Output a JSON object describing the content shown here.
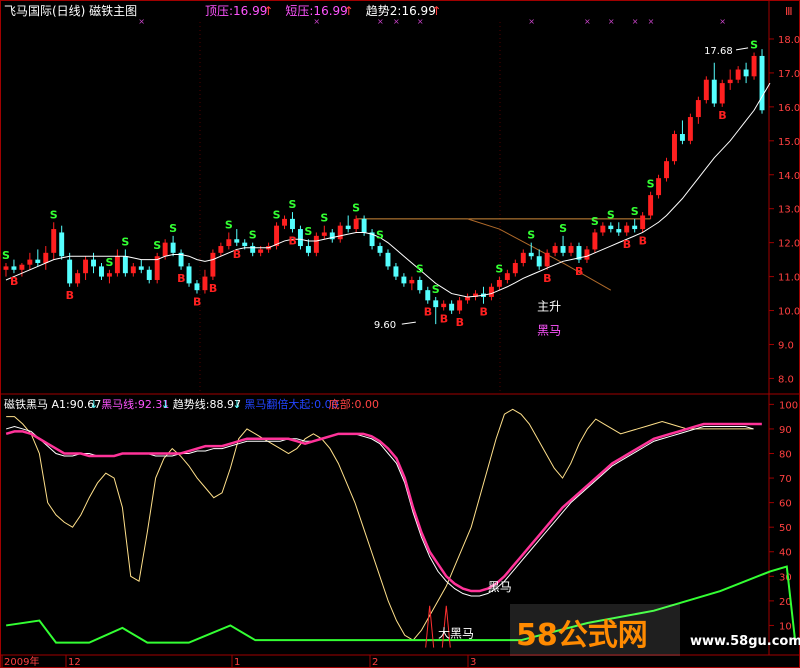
{
  "top_panel": {
    "title": "飞马国际(日线) 磁铁主图",
    "indicators": [
      {
        "label": "顶压:16.99",
        "arrow": "↑",
        "color": "#ff55ff"
      },
      {
        "label": "短压:16.99",
        "arrow": "↑",
        "color": "#ff55ff"
      },
      {
        "label": "趋势2:16.99",
        "arrow": "↑",
        "color": "#ffffff"
      }
    ],
    "corner_label": "Ⅲ"
  },
  "bottom_panel": {
    "indicators": [
      {
        "label": "磁铁黑马 A1:90.67",
        "arrow": "↓",
        "color": "#ffffff"
      },
      {
        "label": "黑马线:92.31",
        "arrow": "↓",
        "color": "#ff55ff"
      },
      {
        "label": "趋势线:88.97",
        "arrow": "↓",
        "color": "#ffffff"
      },
      {
        "label": "黑马翻倍大起:0.00",
        "arrow": "",
        "color": "#2244ff"
      },
      {
        "label": "底部:0.00",
        "arrow": "",
        "color": "#ff4444"
      }
    ]
  },
  "x_axis": {
    "labels": [
      "2009年",
      "12",
      "1",
      "2",
      "3"
    ]
  },
  "watermark": {
    "brand": "58公式网",
    "url": "www.58gu.com"
  },
  "colors": {
    "up": "#ff2020",
    "down": "#55ffff",
    "ma": "#ffffff",
    "ma2": "#ffe08a",
    "pink": "#ff3399",
    "green": "#33ff33",
    "pink_line": "#ff55ff"
  },
  "chart_data": [
    {
      "type": "candlestick",
      "title": "",
      "ylim": [
        7.6,
        18.5
      ],
      "y_ticks": [
        8.0,
        9.0,
        10.0,
        11.0,
        12.0,
        13.0,
        14.0,
        15.0,
        16.0,
        17.0,
        18.0
      ],
      "ohlc": [
        [
          11.2,
          11.4,
          11.0,
          11.3
        ],
        [
          11.3,
          11.5,
          11.1,
          11.2
        ],
        [
          11.2,
          11.4,
          11.0,
          11.35
        ],
        [
          11.35,
          11.7,
          11.2,
          11.5
        ],
        [
          11.5,
          11.8,
          11.3,
          11.4
        ],
        [
          11.4,
          11.9,
          11.2,
          11.7
        ],
        [
          11.7,
          12.6,
          11.5,
          12.4
        ],
        [
          12.3,
          12.5,
          11.5,
          11.6
        ],
        [
          11.5,
          11.7,
          10.7,
          10.8
        ],
        [
          10.8,
          11.2,
          10.7,
          11.1
        ],
        [
          11.1,
          11.6,
          10.9,
          11.5
        ],
        [
          11.5,
          11.7,
          11.1,
          11.3
        ],
        [
          11.3,
          11.4,
          10.9,
          11.0
        ],
        [
          11.0,
          11.2,
          10.8,
          11.1
        ],
        [
          11.1,
          11.8,
          11.0,
          11.6
        ],
        [
          11.6,
          11.8,
          11.0,
          11.1
        ],
        [
          11.1,
          11.4,
          11.0,
          11.3
        ],
        [
          11.3,
          11.5,
          11.1,
          11.2
        ],
        [
          11.2,
          11.3,
          10.8,
          10.9
        ],
        [
          10.9,
          11.7,
          10.8,
          11.6
        ],
        [
          11.6,
          12.1,
          11.5,
          12.0
        ],
        [
          12.0,
          12.2,
          11.6,
          11.7
        ],
        [
          11.7,
          11.8,
          11.2,
          11.3
        ],
        [
          11.3,
          11.4,
          10.7,
          10.8
        ],
        [
          10.8,
          10.9,
          10.5,
          10.6
        ],
        [
          10.6,
          11.2,
          10.5,
          11.0
        ],
        [
          11.0,
          11.8,
          10.9,
          11.7
        ],
        [
          11.7,
          12.0,
          11.6,
          11.9
        ],
        [
          11.9,
          12.3,
          11.8,
          12.1
        ],
        [
          12.1,
          12.4,
          11.9,
          12.0
        ],
        [
          12.0,
          12.1,
          11.8,
          11.9
        ],
        [
          11.9,
          12.0,
          11.6,
          11.7
        ],
        [
          11.7,
          11.9,
          11.6,
          11.8
        ],
        [
          11.8,
          12.0,
          11.7,
          11.9
        ],
        [
          11.9,
          12.6,
          11.8,
          12.5
        ],
        [
          12.5,
          12.8,
          12.4,
          12.7
        ],
        [
          12.7,
          12.9,
          12.3,
          12.4
        ],
        [
          12.4,
          12.5,
          11.8,
          11.9
        ],
        [
          11.9,
          12.1,
          11.6,
          11.7
        ],
        [
          11.7,
          12.3,
          11.6,
          12.2
        ],
        [
          12.2,
          12.5,
          12.1,
          12.3
        ],
        [
          12.3,
          12.4,
          12.0,
          12.1
        ],
        [
          12.1,
          12.6,
          12.0,
          12.5
        ],
        [
          12.5,
          12.8,
          12.3,
          12.4
        ],
        [
          12.4,
          12.8,
          12.3,
          12.7
        ],
        [
          12.7,
          12.8,
          12.2,
          12.3
        ],
        [
          12.3,
          12.4,
          11.8,
          11.9
        ],
        [
          11.9,
          12.0,
          11.6,
          11.7
        ],
        [
          11.7,
          11.8,
          11.2,
          11.3
        ],
        [
          11.3,
          11.4,
          10.9,
          11.0
        ],
        [
          11.0,
          11.1,
          10.7,
          10.8
        ],
        [
          10.8,
          11.0,
          10.6,
          10.9
        ],
        [
          10.9,
          11.0,
          10.5,
          10.6
        ],
        [
          10.6,
          10.7,
          10.2,
          10.3
        ],
        [
          10.3,
          10.4,
          9.6,
          10.1
        ],
        [
          10.1,
          10.3,
          10.0,
          10.2
        ],
        [
          10.2,
          10.3,
          9.9,
          10.0
        ],
        [
          10.0,
          10.4,
          9.9,
          10.3
        ],
        [
          10.3,
          10.5,
          10.2,
          10.4
        ],
        [
          10.4,
          10.6,
          10.3,
          10.5
        ],
        [
          10.5,
          10.7,
          10.2,
          10.4
        ],
        [
          10.4,
          10.8,
          10.3,
          10.7
        ],
        [
          10.7,
          11.0,
          10.6,
          10.9
        ],
        [
          10.9,
          11.2,
          10.8,
          11.1
        ],
        [
          11.1,
          11.5,
          11.0,
          11.4
        ],
        [
          11.4,
          11.8,
          11.3,
          11.7
        ],
        [
          11.7,
          12.0,
          11.5,
          11.6
        ],
        [
          11.6,
          11.8,
          11.2,
          11.3
        ],
        [
          11.3,
          11.8,
          11.2,
          11.7
        ],
        [
          11.7,
          12.0,
          11.6,
          11.9
        ],
        [
          11.9,
          12.2,
          11.6,
          11.7
        ],
        [
          11.7,
          12.0,
          11.6,
          11.9
        ],
        [
          11.9,
          12.0,
          11.4,
          11.5
        ],
        [
          11.5,
          11.9,
          11.4,
          11.8
        ],
        [
          11.8,
          12.4,
          11.7,
          12.3
        ],
        [
          12.3,
          12.6,
          12.2,
          12.5
        ],
        [
          12.5,
          12.6,
          12.3,
          12.4
        ],
        [
          12.4,
          12.6,
          12.2,
          12.3
        ],
        [
          12.3,
          12.6,
          12.2,
          12.5
        ],
        [
          12.5,
          12.7,
          12.3,
          12.4
        ],
        [
          12.4,
          12.9,
          12.3,
          12.8
        ],
        [
          12.8,
          13.5,
          12.7,
          13.4
        ],
        [
          13.4,
          14.0,
          13.3,
          13.9
        ],
        [
          13.9,
          14.5,
          13.8,
          14.4
        ],
        [
          14.4,
          15.3,
          14.3,
          15.2
        ],
        [
          15.2,
          15.6,
          14.9,
          15.0
        ],
        [
          15.0,
          15.8,
          14.9,
          15.7
        ],
        [
          15.7,
          16.3,
          15.5,
          16.2
        ],
        [
          16.2,
          16.9,
          16.1,
          16.8
        ],
        [
          16.8,
          17.3,
          16.0,
          16.1
        ],
        [
          16.1,
          16.8,
          16.0,
          16.7
        ],
        [
          16.7,
          17.1,
          16.5,
          16.8
        ],
        [
          16.8,
          17.2,
          16.7,
          17.1
        ],
        [
          17.1,
          17.3,
          16.7,
          16.9
        ],
        [
          16.9,
          17.6,
          16.8,
          17.5
        ],
        [
          17.5,
          17.7,
          15.8,
          15.9
        ]
      ],
      "ma_line": [
        10.9,
        11.0,
        11.1,
        11.2,
        11.3,
        11.4,
        11.5,
        11.55,
        11.6,
        11.6,
        11.6,
        11.6,
        11.6,
        11.6,
        11.6,
        11.6,
        11.55,
        11.5,
        11.5,
        11.5,
        11.6,
        11.65,
        11.65,
        11.6,
        11.5,
        11.45,
        11.5,
        11.6,
        11.7,
        11.8,
        11.85,
        11.85,
        11.85,
        11.85,
        11.95,
        12.05,
        12.1,
        12.1,
        12.05,
        12.05,
        12.1,
        12.15,
        12.2,
        12.25,
        12.3,
        12.3,
        12.25,
        12.15,
        12.0,
        11.8,
        11.6,
        11.4,
        11.2,
        11.0,
        10.8,
        10.65,
        10.5,
        10.45,
        10.4,
        10.42,
        10.45,
        10.5,
        10.6,
        10.7,
        10.82,
        10.95,
        11.05,
        11.15,
        11.25,
        11.35,
        11.45,
        11.5,
        11.55,
        11.6,
        11.7,
        11.8,
        11.9,
        12.0,
        12.1,
        12.2,
        12.3,
        12.45,
        12.6,
        12.8,
        13.05,
        13.3,
        13.6,
        13.9,
        14.2,
        14.5,
        14.75,
        15.0,
        15.3,
        15.6,
        15.9,
        16.3,
        16.7
      ],
      "ma2_line": [
        null,
        null,
        null,
        null,
        null,
        null,
        null,
        null,
        null,
        null,
        null,
        null,
        null,
        null,
        null,
        null,
        null,
        null,
        null,
        null,
        null,
        null,
        null,
        null,
        null,
        null,
        null,
        null,
        null,
        null,
        null,
        null,
        null,
        null,
        null,
        null,
        null,
        null,
        null,
        null,
        null,
        null,
        null,
        null,
        null,
        null,
        null,
        null,
        null,
        null,
        null,
        null,
        null,
        null,
        null,
        null,
        null,
        null,
        null,
        null,
        null,
        null,
        null,
        null,
        null,
        null,
        null,
        null,
        null,
        null,
        null,
        null,
        null,
        null,
        null,
        null,
        null,
        null,
        null,
        null,
        null,
        null,
        null,
        null,
        null,
        null,
        null,
        null,
        null,
        null,
        null,
        null,
        null,
        null,
        null,
        null,
        null
      ],
      "flat_line": {
        "from_index": 44,
        "to_index": 81,
        "value": 12.7
      },
      "brown_curve": [
        [
          58,
          12.7
        ],
        [
          62,
          12.4
        ],
        [
          66,
          11.9
        ],
        [
          70,
          11.4
        ],
        [
          73,
          11.0
        ],
        [
          76,
          10.6
        ]
      ],
      "s_signals": [
        0,
        6,
        13,
        15,
        19,
        21,
        28,
        31,
        34,
        36,
        38,
        40,
        44,
        47,
        52,
        54,
        62,
        66,
        70,
        74,
        76,
        79,
        81,
        94
      ],
      "b_signals": [
        1,
        8,
        22,
        24,
        26,
        29,
        36,
        53,
        55,
        57,
        60,
        68,
        72,
        78,
        80,
        90
      ],
      "annotations": [
        {
          "text": "17.68",
          "index": 94,
          "value": 17.68
        },
        {
          "text": "9.60",
          "index": 52,
          "value": 9.6
        },
        {
          "text": "主升",
          "index": 68,
          "value": 10.0,
          "color": "#ffffff"
        },
        {
          "text": "黑马",
          "index": 68,
          "value": 9.3,
          "color": "#ff55ff"
        }
      ]
    },
    {
      "type": "line",
      "title": "",
      "ylim": [
        0,
        103
      ],
      "y_ticks": [
        10,
        20,
        30,
        40,
        50,
        60,
        70,
        80,
        90,
        100
      ],
      "pink": [
        88,
        89,
        89,
        88,
        86,
        84,
        82,
        80,
        80,
        80,
        79,
        79,
        79,
        79,
        80,
        80,
        80,
        80,
        80,
        80,
        80,
        80,
        81,
        82,
        83,
        83,
        83,
        84,
        85,
        86,
        86,
        86,
        86,
        86,
        86,
        85,
        84,
        85,
        86,
        87,
        88,
        88,
        88,
        88,
        87,
        85,
        82,
        78,
        70,
        58,
        48,
        40,
        35,
        30,
        27,
        25,
        24,
        24,
        25,
        27,
        30,
        34,
        38,
        42,
        46,
        50,
        54,
        58,
        61,
        64,
        67,
        70,
        73,
        76,
        78,
        80,
        82,
        84,
        86,
        87,
        88,
        89,
        90,
        91,
        92,
        92,
        92,
        92,
        92,
        92,
        92,
        92
      ],
      "white": [
        90,
        91,
        90,
        89,
        86,
        83,
        80,
        79,
        79,
        80,
        80,
        79,
        79,
        79,
        80,
        80,
        80,
        80,
        79,
        79,
        79,
        80,
        80,
        81,
        81,
        82,
        82,
        83,
        84,
        85,
        85,
        85,
        85,
        85,
        86,
        86,
        85,
        85,
        86,
        87,
        88,
        88,
        88,
        87,
        86,
        84,
        80,
        76,
        68,
        56,
        46,
        38,
        32,
        28,
        25,
        23,
        22,
        22,
        23,
        25,
        28,
        32,
        36,
        40,
        44,
        48,
        52,
        56,
        60,
        63,
        66,
        69,
        72,
        75,
        77,
        79,
        81,
        83,
        85,
        86,
        87,
        88,
        89,
        90,
        91,
        91,
        91,
        91,
        91,
        91,
        90
      ],
      "yellow": [
        95,
        95,
        92,
        88,
        80,
        60,
        55,
        52,
        50,
        55,
        62,
        68,
        72,
        70,
        58,
        30,
        28,
        48,
        70,
        78,
        82,
        79,
        75,
        70,
        66,
        62,
        64,
        74,
        86,
        90,
        88,
        86,
        84,
        82,
        80,
        82,
        86,
        88,
        86,
        82,
        76,
        68,
        60,
        50,
        40,
        30,
        20,
        12,
        6,
        4,
        8,
        14,
        20,
        26,
        34,
        42,
        50,
        62,
        74,
        86,
        96,
        98,
        96,
        92,
        86,
        80,
        74,
        70,
        76,
        84,
        90,
        94,
        92,
        90,
        88,
        89,
        90,
        91,
        92,
        93,
        92,
        91,
        90,
        90,
        90,
        90,
        90,
        90,
        90,
        90,
        90
      ],
      "green_sawtooth": [
        [
          0,
          10
        ],
        [
          4,
          12
        ],
        [
          6,
          3
        ],
        [
          10,
          3
        ],
        [
          14,
          9
        ],
        [
          17,
          3
        ],
        [
          22,
          3
        ],
        [
          27,
          10
        ],
        [
          30,
          4
        ],
        [
          35,
          4
        ],
        [
          46,
          4
        ],
        [
          52,
          4
        ],
        [
          62,
          4
        ],
        [
          70,
          11
        ],
        [
          78,
          16
        ],
        [
          86,
          24
        ],
        [
          92,
          32
        ],
        [
          94,
          34
        ],
        [
          95,
          4
        ]
      ],
      "spikes": [
        {
          "index": 51,
          "value": 18
        },
        {
          "index": 53,
          "value": 18
        }
      ],
      "annotations": [
        {
          "text": "黑马",
          "index": 58,
          "value": 24
        },
        {
          "text": "大黑马",
          "index": 52,
          "value": 5
        }
      ]
    }
  ]
}
